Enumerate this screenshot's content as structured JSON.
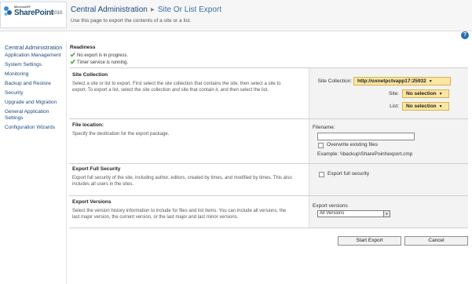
{
  "header": {
    "logo_ms": "Microsoft®",
    "logo_product": "SharePoint",
    "logo_version": "2010",
    "breadcrumb_root": "Central Administration",
    "breadcrumb_sep": "▸",
    "page_title": "Site Or List Export",
    "description": "Use this page to export the contents of a site or a list.",
    "help_icon": "?"
  },
  "sidebar": {
    "heading": "Central Administration",
    "items": [
      "Application Management",
      "System Settings",
      "Monitoring",
      "Backup and Restore",
      "Security",
      "Upgrade and Migration",
      "General Application Settings",
      "Configuration Wizards"
    ]
  },
  "readiness": {
    "title": "Readiness",
    "items": [
      "No export is in progress.",
      "Timer service is running."
    ]
  },
  "site_collection": {
    "title": "Site Collection",
    "description": "Select a site or list to export.  First select the site collection that contains the site, then select a site to export. To export a list, select the site collection and site that contain it, and then select the list.",
    "site_collection_label": "Site Collection:",
    "site_collection_value": "http://oxnetpctvapp17:25932",
    "site_label": "Site:",
    "site_value": "No selection",
    "list_label": "List:",
    "list_value": "No selection"
  },
  "file_location": {
    "title": "File location:",
    "description": "Specify the destination for the export package.",
    "filename_label": "Filename:",
    "filename_value": "",
    "overwrite_label": "Overwrite existing files",
    "example": "Example: \\\\backup\\SharePoint\\export.cmp"
  },
  "full_security": {
    "title": "Export Full Security",
    "description": "Export full security of the site, including author, editors, created by times, and modified by times. This also includes all users in the sites.",
    "checkbox_label": "Export full security"
  },
  "export_versions": {
    "title": "Export Versions",
    "description": "Select the version history information to include for files and list items. You can include all versions, the last major version, the current version, or the last major and last minor versions.",
    "label": "Export versions",
    "selected": "All Versions"
  },
  "buttons": {
    "start_export": "Start Export",
    "cancel": "Cancel"
  },
  "colors": {
    "accent": "#1c4a7d",
    "selector_bg": "#fbe6a3"
  }
}
